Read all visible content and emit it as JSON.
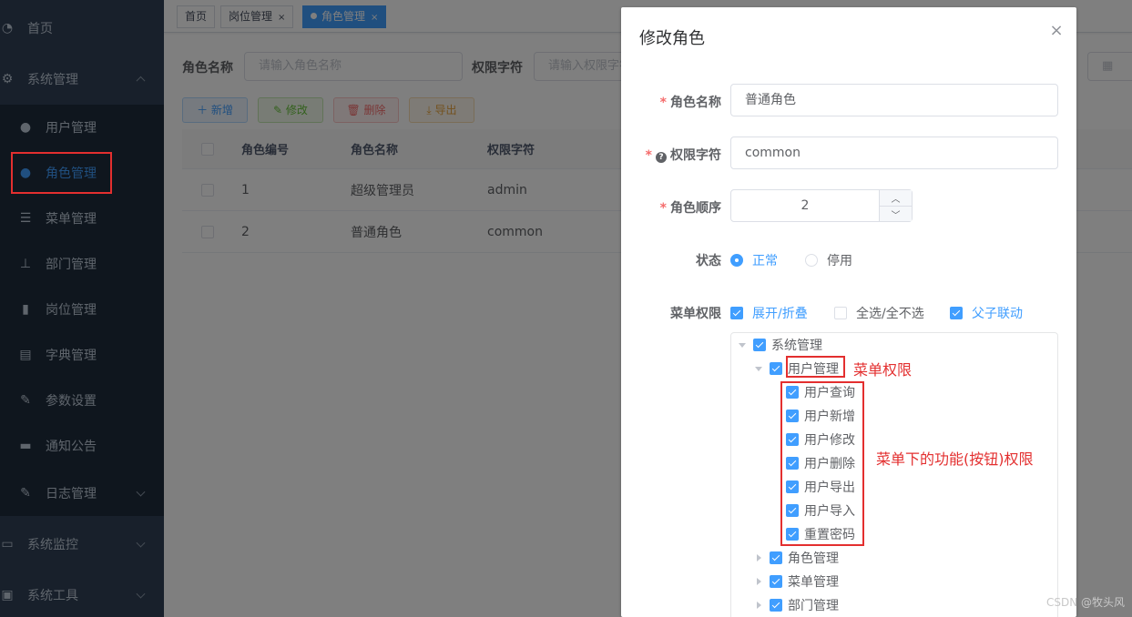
{
  "sidebar": {
    "items": [
      {
        "label": "首页"
      },
      {
        "label": "系统管理"
      },
      {
        "label": "用户管理"
      },
      {
        "label": "角色管理"
      },
      {
        "label": "菜单管理"
      },
      {
        "label": "部门管理"
      },
      {
        "label": "岗位管理"
      },
      {
        "label": "字典管理"
      },
      {
        "label": "参数设置"
      },
      {
        "label": "通知公告"
      },
      {
        "label": "日志管理"
      },
      {
        "label": "系统监控"
      },
      {
        "label": "系统工具"
      }
    ]
  },
  "tags": [
    {
      "label": "首页"
    },
    {
      "label": "岗位管理",
      "close": "×"
    },
    {
      "label": "角色管理",
      "close": "×"
    }
  ],
  "search": {
    "role_name_label": "角色名称",
    "role_name_placeholder": "请输入角色名称",
    "role_key_label": "权限字符",
    "role_key_placeholder": "请输入权限字符"
  },
  "toolbar": {
    "add": "新增",
    "edit": "修改",
    "delete": "删除",
    "export": "导出"
  },
  "table": {
    "headers": [
      "角色编号",
      "角色名称",
      "权限字符"
    ],
    "rows": [
      {
        "id": "1",
        "name": "超级管理员",
        "key": "admin"
      },
      {
        "id": "2",
        "name": "普通角色",
        "key": "common"
      }
    ]
  },
  "dialog": {
    "title": "修改角色",
    "close": "×",
    "role_name_label": "角色名称",
    "role_name_value": "普通角色",
    "role_key_label": "权限字符",
    "role_key_value": "common",
    "role_sort_label": "角色顺序",
    "role_sort_value": "2",
    "status_label": "状态",
    "status_normal": "正常",
    "status_disabled": "停用",
    "menu_perm_label": "菜单权限",
    "expand_label": "展开/折叠",
    "select_all_label": "全选/全不选",
    "linkage_label": "父子联动",
    "tree": {
      "root": "系统管理",
      "user_mgmt": "用户管理",
      "user_children": [
        "用户查询",
        "用户新增",
        "用户修改",
        "用户删除",
        "用户导出",
        "用户导入",
        "重置密码"
      ],
      "siblings": [
        "角色管理",
        "菜单管理",
        "部门管理"
      ]
    }
  },
  "annotations": {
    "menu_perm": "菜单权限",
    "button_perm": "菜单下的功能(按钮)权限"
  },
  "watermark": "CSDN @牧头风",
  "colors": {
    "sidebar_bg": "#304156",
    "primary": "#409eff",
    "annotation_red": "#e32f2f"
  }
}
